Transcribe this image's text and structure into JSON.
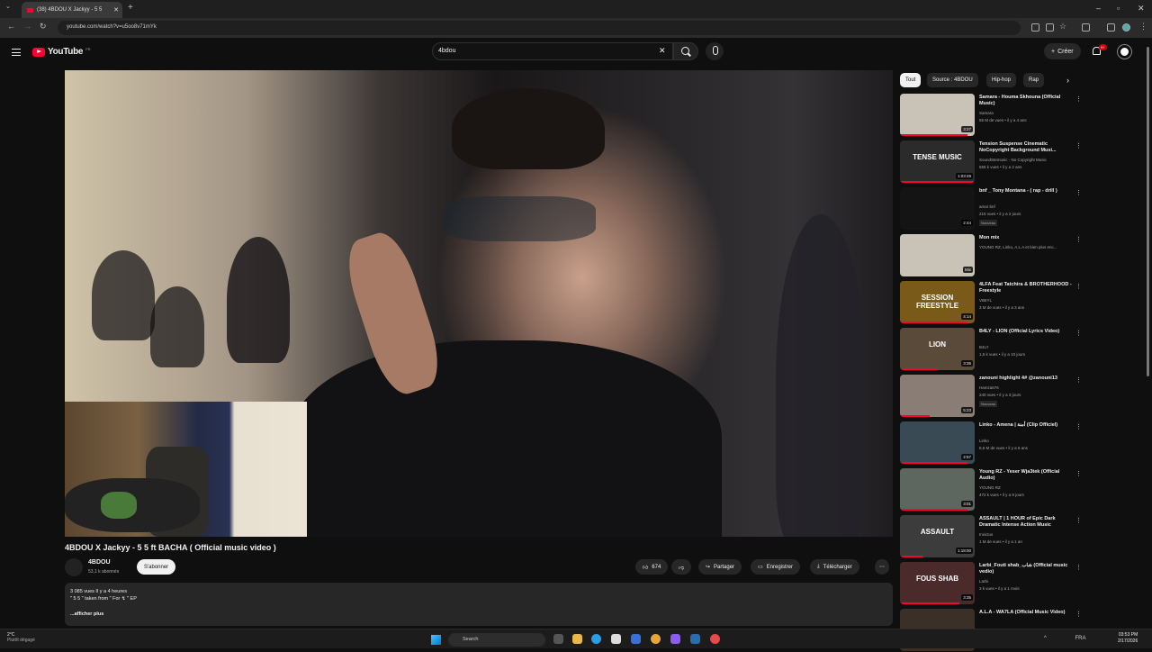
{
  "browser": {
    "tab_title": "(38) 4BDOU X Jackyy - 5 5",
    "url": "youtube.com/watch?v=u5oo8v71mYk"
  },
  "header": {
    "logo_text": "YouTube",
    "logo_region": "FR",
    "search_value": "4bdou",
    "create_label": "Créer",
    "notif_count": "9+"
  },
  "video": {
    "title": "4BDOU X Jackyy - 5 5 ft BACHA ( Official music video )",
    "channel": "4BDOU",
    "subscribers": "53,1 k abonnés",
    "subscribe_label": "S'abonner",
    "likes": "674",
    "share_label": "Partager",
    "save_label": "Enregistrer",
    "download_label": "Télécharger",
    "desc_line1": "3 085 vues  Il y a 4 heures",
    "desc_line2": "\" 5 5 \" taken from \" For ↯ \" EP",
    "desc_more": "...afficher plus"
  },
  "chips": [
    "Tout",
    "Source : 4BDOU",
    "Hip-hop",
    "Rap"
  ],
  "recs": [
    {
      "title": "Samara - Houma Skhouna (Official Music)",
      "channel": "Samara",
      "meta": "55 M de vues • il y a 4 ans",
      "duration": "3:27",
      "badge": "",
      "overlay": "",
      "progress": 0.9,
      "bg": "#c9c2b6"
    },
    {
      "title": "Tension Suspense Cinematic NoCopyright Background Musi...",
      "channel": "SoundStemusic - No Copyright Music",
      "meta": "555 k vues • il y a 2 ans",
      "duration": "1:03:49",
      "badge": "",
      "overlay": "TENSE MUSIC",
      "progress": 1.0,
      "bg": "#2b2b2b"
    },
    {
      "title": "bnf _ Tony Montana - ( rap - drill )",
      "channel": "amar bnf",
      "meta": "215 vues • il y a 2 jours",
      "duration": "2:44",
      "badge": "Nouveau",
      "overlay": "",
      "progress": 0,
      "bg": "#141414"
    },
    {
      "title": "Mon mix",
      "channel": "YOUNG RZ, Linko, A.L.A et bien plus enc...",
      "meta": "",
      "duration": "Mix",
      "badge": "",
      "overlay": "",
      "progress": 0,
      "bg": "#c9c2b6"
    },
    {
      "title": "4LFA Feat Tatchira & BROTHERHOOD - Freestyle",
      "channel": "VIBIYL",
      "meta": "3 M de vues • il y a 3 ans",
      "duration": "4:14",
      "badge": "",
      "overlay": "SESSION FREESTYLE",
      "progress": 0.9,
      "bg": "#7a5a18"
    },
    {
      "title": "B4LY - LION (Official Lyrics Video)",
      "channel": "B4LY",
      "meta": "1,5 k vues • il y a 10 jours",
      "duration": "3:35",
      "badge": "",
      "overlay": "LION",
      "progress": 0.5,
      "bg": "#5a4a3a"
    },
    {
      "title": "zanouni highlight 4# @zanouni13",
      "channel": "Hamza676",
      "meta": "240 vues • il y a 3 jours",
      "duration": "5:23",
      "badge": "Nouveau",
      "overlay": "",
      "progress": 0.4,
      "bg": "#8a7d76"
    },
    {
      "title": "Linko - Amena | أمنة (Clip Officiel)",
      "channel": "Linko",
      "meta": "8,6 M de vues • il y a 6 ans",
      "duration": "2:57",
      "badge": "",
      "overlay": "",
      "progress": 0.9,
      "bg": "#3a4a55"
    },
    {
      "title": "Young RZ - Yeser Wja3tek (Official Audio)",
      "channel": "YOUNG RZ",
      "meta": "472 k vues • il y a 9 jours",
      "duration": "3:01",
      "badge": "",
      "overlay": "",
      "progress": 0.9,
      "bg": "#5e6660"
    },
    {
      "title": "ASSAULT | 1 HOUR of Epic Dark Dramatic Intense Action Music",
      "channel": "Invictus",
      "meta": "1 M de vues • il y a 1 an",
      "duration": "1:18:00",
      "badge": "",
      "overlay": "ASSAULT",
      "progress": 0.3,
      "bg": "#3c3c3c"
    },
    {
      "title": "Larbi_Fouti shab_شاب (Official music vedio)",
      "channel": "Larbi",
      "meta": "3 k vues • il y a 1 mois",
      "duration": "3:35",
      "badge": "",
      "overlay": "FOUS SHAB",
      "progress": 0.8,
      "bg": "#4a2a2a"
    },
    {
      "title": "A.L.A - WA7LA (Official Music Video)",
      "channel": "",
      "meta": "",
      "duration": "",
      "badge": "",
      "overlay": "",
      "progress": 0,
      "bg": "#3a3028"
    }
  ],
  "taskbar": {
    "weather_temp": "2°C",
    "weather_desc": "Plutôt dégagé",
    "search_label": "Search",
    "lang": "FRA",
    "time": "03:53 PM",
    "date": "2/17/2026"
  },
  "colors": {
    "youtube_red": "#ff0033",
    "bg": "#0f0f0f",
    "chip": "#272727"
  }
}
